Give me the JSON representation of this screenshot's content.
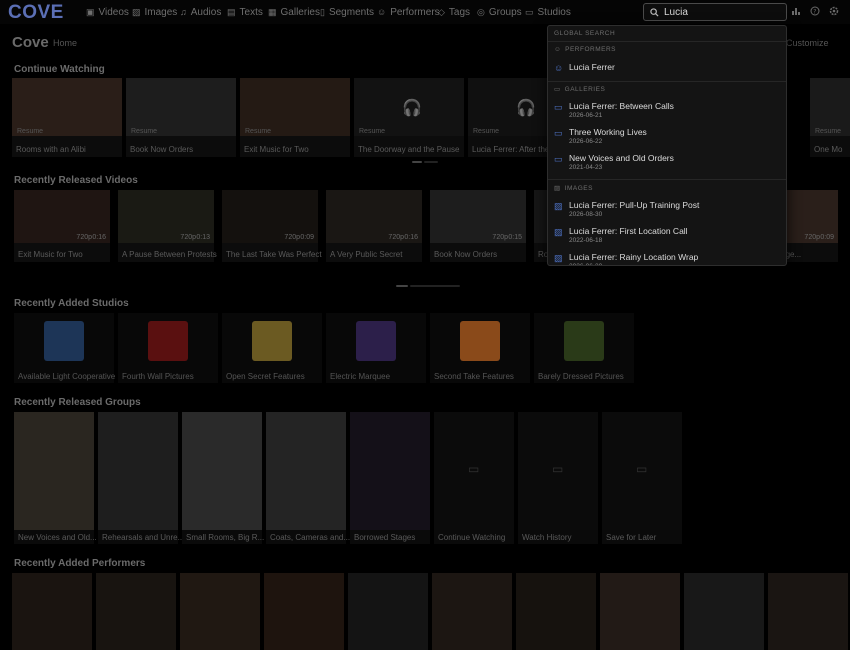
{
  "nav": {
    "logo": "COVE",
    "items": [
      {
        "label": "Videos",
        "icon": "▣"
      },
      {
        "label": "Images",
        "icon": "▨"
      },
      {
        "label": "Audios",
        "icon": "♫"
      },
      {
        "label": "Texts",
        "icon": "▤"
      },
      {
        "label": "Galleries",
        "icon": "▦"
      },
      {
        "label": "Segments",
        "icon": "▯"
      },
      {
        "label": "Performers",
        "icon": "☺"
      },
      {
        "label": "Tags",
        "icon": "◇"
      },
      {
        "label": "Groups",
        "icon": "◎"
      },
      {
        "label": "Studios",
        "icon": "▭"
      }
    ],
    "search_value": "Lucia",
    "search_placeholder": "Search"
  },
  "header": {
    "brand": "Cove",
    "home": "Home",
    "customize": "Customize"
  },
  "sections": {
    "continue_watching": "Continue Watching",
    "recently_released_videos": "Recently Released Videos",
    "recently_added_studios": "Recently Added Studios",
    "recently_released_groups": "Recently Released Groups",
    "recently_added_performers": "Recently Added Performers"
  },
  "continue_watching": [
    {
      "title": "Rooms with an Alibi",
      "badge": "Resume"
    },
    {
      "title": "Book Now Orders",
      "badge": "Resume"
    },
    {
      "title": "Exit Music for Two",
      "badge": "Resume"
    },
    {
      "title": "The Doorway and the Pause",
      "badge": "Resume"
    },
    {
      "title": "Lucia Ferrer: After the",
      "badge": "Resume"
    },
    {
      "title": "One Mo",
      "badge": "Resume"
    }
  ],
  "released_videos": [
    {
      "title": "Exit Music for Two",
      "res": "720p",
      "dur": "0:16"
    },
    {
      "title": "A Pause Between Protests",
      "res": "720p",
      "dur": "0:13"
    },
    {
      "title": "The Last Take Was Perfect",
      "res": "720p",
      "dur": "0:09"
    },
    {
      "title": "A Very Public Secret",
      "res": "720p",
      "dur": "0:16"
    },
    {
      "title": "Book Now Orders",
      "res": "720p",
      "dur": "0:15"
    },
    {
      "title": "Ro",
      "res": "",
      "dur": ""
    },
    {
      "title": "...me of stage...",
      "res": "720p",
      "dur": "0:09"
    }
  ],
  "studios": [
    {
      "name": "Available Light Cooperative",
      "color": "#1d3557"
    },
    {
      "name": "Fourth Wall Pictures",
      "color": "#5a1010"
    },
    {
      "name": "Open Secret Features",
      "color": "#6b5a22"
    },
    {
      "name": "Electric Marquee",
      "color": "#2c1f4a"
    },
    {
      "name": "Second Take Features",
      "color": "#8a4a1a"
    },
    {
      "name": "Barely Dressed Pictures",
      "color": "#2a3a18"
    }
  ],
  "groups": [
    {
      "name": "New Voices and Old..."
    },
    {
      "name": "Rehearsals and Unre..."
    },
    {
      "name": "Small Rooms, Big R..."
    },
    {
      "name": "Coats, Cameras and..."
    },
    {
      "name": "Borrowed Stages"
    },
    {
      "name": "Continue Watching"
    },
    {
      "name": "Watch History"
    },
    {
      "name": "Save for Later"
    }
  ],
  "dropdown": {
    "global": "Global Search",
    "performers_head": "Performers",
    "galleries_head": "Galleries",
    "images_head": "Images",
    "performers": [
      {
        "title": "Lucia Ferrer"
      }
    ],
    "galleries": [
      {
        "title": "Lucia Ferrer: Between Calls",
        "date": "2026-06-21"
      },
      {
        "title": "Three Working Lives",
        "date": "2026-06-22"
      },
      {
        "title": "New Voices and Old Orders",
        "date": "2021-04-23"
      }
    ],
    "images": [
      {
        "title": "Lucia Ferrer: Pull-Up Training Post",
        "date": "2026-08-30"
      },
      {
        "title": "Lucia Ferrer: First Location Call",
        "date": "2022-06-18"
      },
      {
        "title": "Lucia Ferrer: Rainy Location Wrap",
        "date": "2026-06-30"
      }
    ]
  },
  "colors": {
    "accent": "#4f74c9",
    "logo": "#5b6fb5"
  }
}
